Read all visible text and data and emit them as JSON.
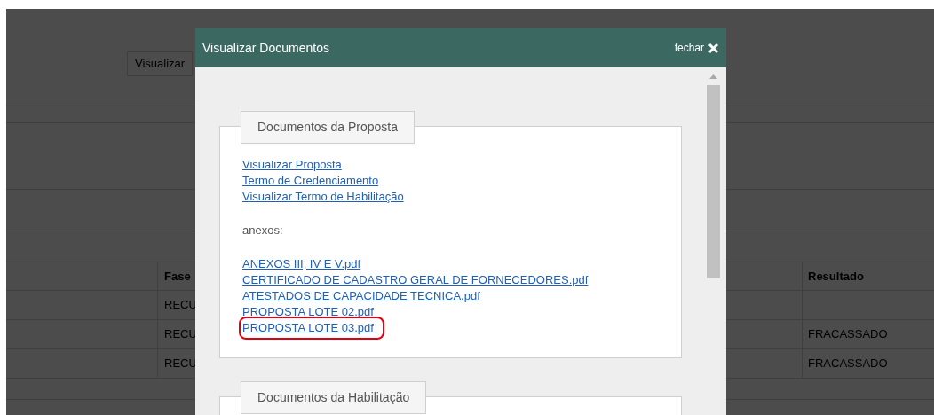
{
  "background": {
    "button": "Visualizar",
    "table": {
      "columns": [
        "Fase",
        "Resultado"
      ],
      "rows": [
        [
          "RECU",
          ""
        ],
        [
          "RECU",
          "FRACASSADO"
        ],
        [
          "RECU",
          "FRACASSADO"
        ]
      ]
    }
  },
  "modal": {
    "title": "Visualizar Documentos",
    "close_label": "fechar",
    "sections": [
      {
        "legend": "Documentos da Proposta",
        "links": [
          "Visualizar Proposta",
          "Termo de Credenciamento",
          "Visualizar Termo de Habilitação"
        ],
        "attachments_label": "anexos:",
        "attachments": [
          {
            "name": "ANEXOS III, IV E V.pdf",
            "highlighted": false
          },
          {
            "name": "CERTIFICADO DE CADASTRO GERAL DE FORNECEDORES.pdf",
            "highlighted": false
          },
          {
            "name": "ATESTADOS DE CAPACIDADE TECNICA.pdf",
            "highlighted": false
          },
          {
            "name": "PROPOSTA LOTE 02.pdf",
            "highlighted": false
          },
          {
            "name": "PROPOSTA LOTE 03.pdf",
            "highlighted": true
          }
        ]
      },
      {
        "legend": "Documentos da Habilitação"
      }
    ]
  }
}
